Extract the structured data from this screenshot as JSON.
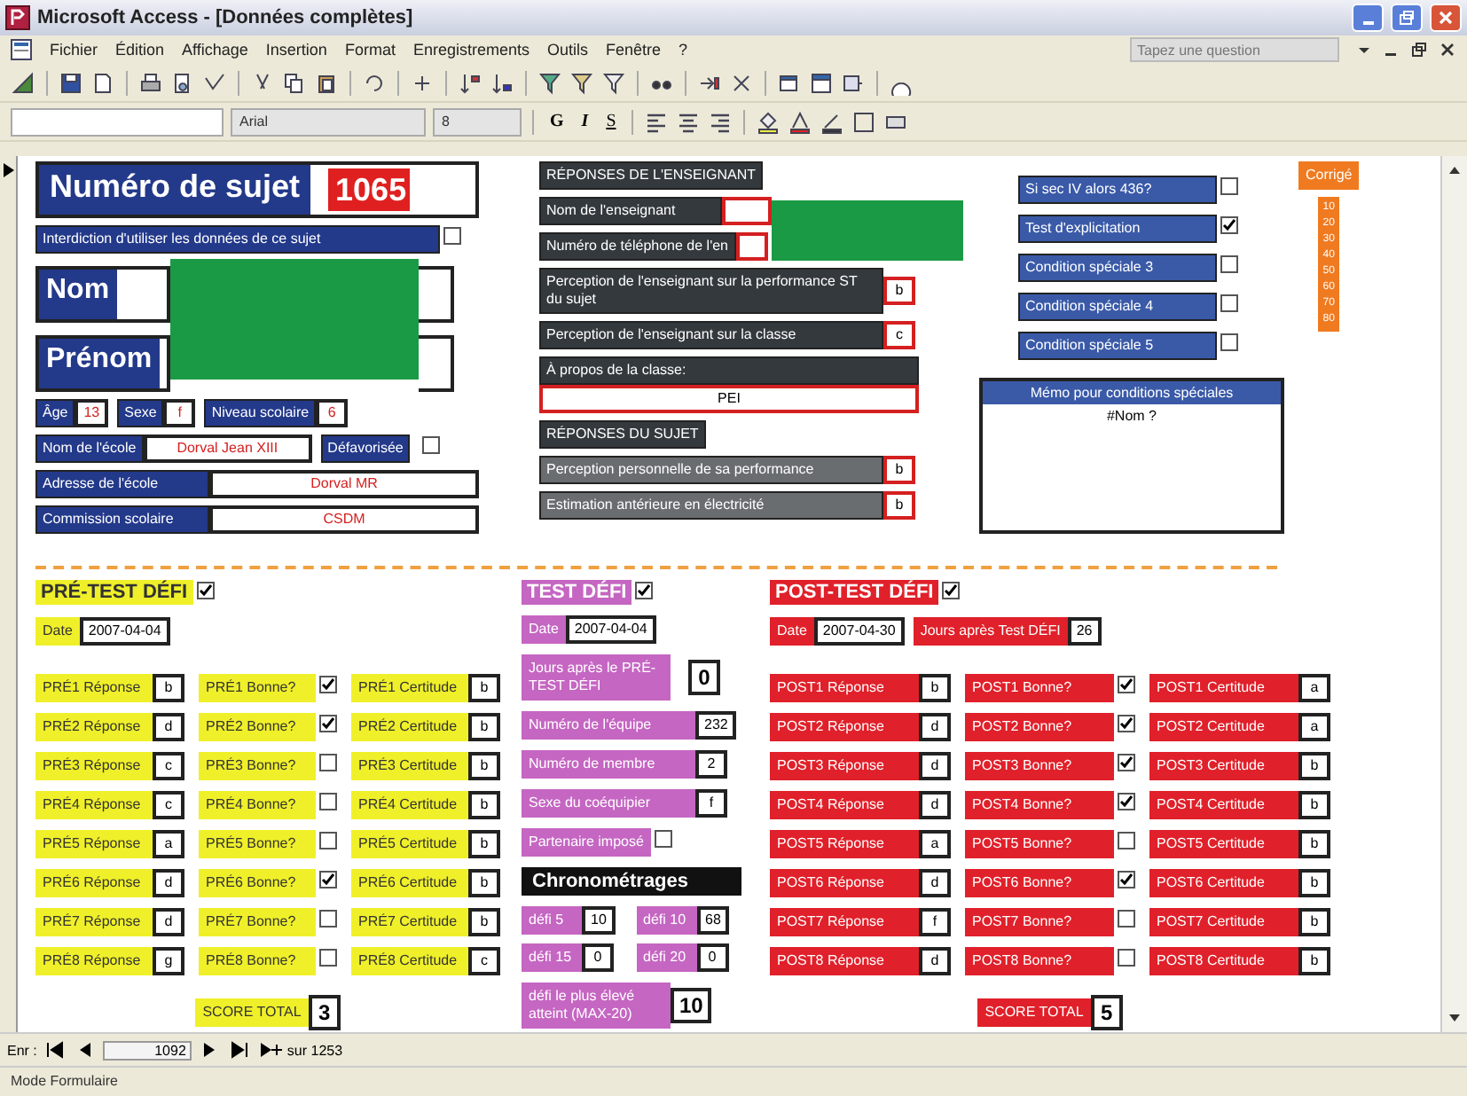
{
  "window": {
    "title": "Microsoft Access - [Données complètes]"
  },
  "menu": [
    "Fichier",
    "Édition",
    "Affichage",
    "Insertion",
    "Format",
    "Enregistrements",
    "Outils",
    "Fenêtre",
    "?"
  ],
  "help_search": {
    "placeholder": "Tapez une question"
  },
  "format_toolbar": {
    "font": "Arial",
    "size": "8",
    "style_buttons": [
      "G",
      "I",
      "S"
    ]
  },
  "subject": {
    "number_label": "Numéro de sujet",
    "number": "1065",
    "ban_label": "Interdiction d'utiliser les données de ce sujet",
    "ban_checked": false,
    "name_label": "Nom",
    "first_name_label": "Prénom",
    "age_label": "Âge",
    "age": "13",
    "sex_label": "Sexe",
    "sex": "f",
    "grade_label": "Niveau scolaire",
    "grade": "6",
    "school_label": "Nom de l'école",
    "school": "Dorval Jean XIII",
    "disadvantaged_label": "Défavorisée",
    "disadvantaged": false,
    "address_label": "Adresse de l'école",
    "address": "Dorval MR",
    "board_label": "Commission scolaire",
    "board": "CSDM"
  },
  "teacher": {
    "heading": "RÉPONSES DE L'ENSEIGNANT",
    "name_label": "Nom de l'enseignant",
    "phone_label": "Numéro de téléphone de l'en",
    "perceptions": [
      {
        "label": "Perception de l'enseignant sur la performance ST du sujet",
        "value": "b"
      },
      {
        "label": "Perception de l'enseignant sur la classe",
        "value": "c"
      }
    ],
    "class_label": "À propos de la classe:",
    "class_value": "PEI"
  },
  "student": {
    "heading": "RÉPONSES DU SUJET",
    "fields": [
      {
        "label": "Perception personnelle de sa performance",
        "value": "b"
      },
      {
        "label": "Estimation antérieure en électricité",
        "value": "b"
      }
    ]
  },
  "conditions": [
    {
      "label": "Si sec IV alors 436?",
      "checked": false
    },
    {
      "label": "Test d'explicitation",
      "checked": true
    },
    {
      "label": "Condition spéciale 3",
      "checked": false
    },
    {
      "label": "Condition spéciale 4",
      "checked": false
    },
    {
      "label": "Condition spéciale 5",
      "checked": false
    }
  ],
  "corrected": {
    "label": "Corrigé",
    "marks": [
      "10",
      "20",
      "30",
      "40",
      "50",
      "60",
      "70",
      "80"
    ]
  },
  "memo": {
    "label": "Mémo pour conditions spéciales",
    "value": "#Nom ?"
  },
  "pre_test": {
    "heading": "PRÉ-TEST DÉFI",
    "done": true,
    "date_label": "Date",
    "date": "2007-04-04",
    "rows": [
      {
        "answer_label": "PRÉ1 Réponse",
        "answer": "b",
        "correct_label": "PRÉ1 Bonne?",
        "correct": true,
        "certainty_label": "PRÉ1 Certitude",
        "certainty": "b"
      },
      {
        "answer_label": "PRÉ2 Réponse",
        "answer": "d",
        "correct_label": "PRÉ2 Bonne?",
        "correct": true,
        "certainty_label": "PRÉ2 Certitude",
        "certainty": "b"
      },
      {
        "answer_label": "PRÉ3 Réponse",
        "answer": "c",
        "correct_label": "PRÉ3 Bonne?",
        "correct": false,
        "certainty_label": "PRÉ3 Certitude",
        "certainty": "b"
      },
      {
        "answer_label": "PRÉ4 Réponse",
        "answer": "c",
        "correct_label": "PRÉ4 Bonne?",
        "correct": false,
        "certainty_label": "PRÉ4 Certitude",
        "certainty": "b"
      },
      {
        "answer_label": "PRÉ5 Réponse",
        "answer": "a",
        "correct_label": "PRÉ5 Bonne?",
        "correct": false,
        "certainty_label": "PRÉ5 Certitude",
        "certainty": "b"
      },
      {
        "answer_label": "PRÉ6 Réponse",
        "answer": "d",
        "correct_label": "PRÉ6 Bonne?",
        "correct": true,
        "certainty_label": "PRÉ6 Certitude",
        "certainty": "b"
      },
      {
        "answer_label": "PRÉ7 Réponse",
        "answer": "d",
        "correct_label": "PRÉ7 Bonne?",
        "correct": false,
        "certainty_label": "PRÉ7 Certitude",
        "certainty": "b"
      },
      {
        "answer_label": "PRÉ8 Réponse",
        "answer": "g",
        "correct_label": "PRÉ8 Bonne?",
        "correct": false,
        "certainty_label": "PRÉ8 Certitude",
        "certainty": "c"
      }
    ],
    "score_label": "SCORE TOTAL",
    "score": "3"
  },
  "test": {
    "heading": "TEST DÉFI",
    "done": true,
    "date_label": "Date",
    "date": "2007-04-04",
    "fields": [
      {
        "kind": "big",
        "label": "Jours après le PRÉ-TEST DÉFI",
        "value": "0"
      },
      {
        "kind": "field",
        "label": "Numéro de l'équipe",
        "value": "232"
      },
      {
        "kind": "field",
        "label": "Numéro de membre",
        "value": "2"
      },
      {
        "kind": "field",
        "label": "Sexe du coéquipier",
        "value": "f"
      },
      {
        "kind": "check",
        "label": "Partenaire imposé",
        "checked": false
      }
    ],
    "timing_heading": "Chronométrages",
    "timings": [
      {
        "label": "défi 5",
        "value": "10"
      },
      {
        "label": "défi 10",
        "value": "68"
      },
      {
        "label": "défi 15",
        "value": "0"
      },
      {
        "label": "défi 20",
        "value": "0"
      }
    ],
    "max_label": "défi le plus élevé atteint (MAX-20)",
    "max": "10"
  },
  "post_test": {
    "heading": "POST-TEST DÉFI",
    "done": true,
    "date_label": "Date",
    "date": "2007-04-30",
    "days_label": "Jours après Test DÉFI",
    "days": "26",
    "rows": [
      {
        "answer_label": "POST1 Réponse",
        "answer": "b",
        "correct_label": "POST1 Bonne?",
        "correct": true,
        "certainty_label": "POST1 Certitude",
        "certainty": "a"
      },
      {
        "answer_label": "POST2 Réponse",
        "answer": "d",
        "correct_label": "POST2 Bonne?",
        "correct": true,
        "certainty_label": "POST2 Certitude",
        "certainty": "a"
      },
      {
        "answer_label": "POST3 Réponse",
        "answer": "d",
        "correct_label": "POST3 Bonne?",
        "correct": true,
        "certainty_label": "POST3 Certitude",
        "certainty": "b"
      },
      {
        "answer_label": "POST4 Réponse",
        "answer": "d",
        "correct_label": "POST4 Bonne?",
        "correct": true,
        "certainty_label": "POST4 Certitude",
        "certainty": "b"
      },
      {
        "answer_label": "POST5 Réponse",
        "answer": "a",
        "correct_label": "POST5 Bonne?",
        "correct": false,
        "certainty_label": "POST5 Certitude",
        "certainty": "b"
      },
      {
        "answer_label": "POST6 Réponse",
        "answer": "d",
        "correct_label": "POST6 Bonne?",
        "correct": true,
        "certainty_label": "POST6 Certitude",
        "certainty": "b"
      },
      {
        "answer_label": "POST7 Réponse",
        "answer": "f",
        "correct_label": "POST7 Bonne?",
        "correct": false,
        "certainty_label": "POST7 Certitude",
        "certainty": "b"
      },
      {
        "answer_label": "POST8 Réponse",
        "answer": "d",
        "correct_label": "POST8 Bonne?",
        "correct": false,
        "certainty_label": "POST8 Certitude",
        "certainty": "b"
      }
    ],
    "score_label": "SCORE TOTAL",
    "score": "5"
  },
  "navigation": {
    "label": "Enr :",
    "record": "1092",
    "total": "sur 1253"
  },
  "status_bar": "Mode Formulaire"
}
